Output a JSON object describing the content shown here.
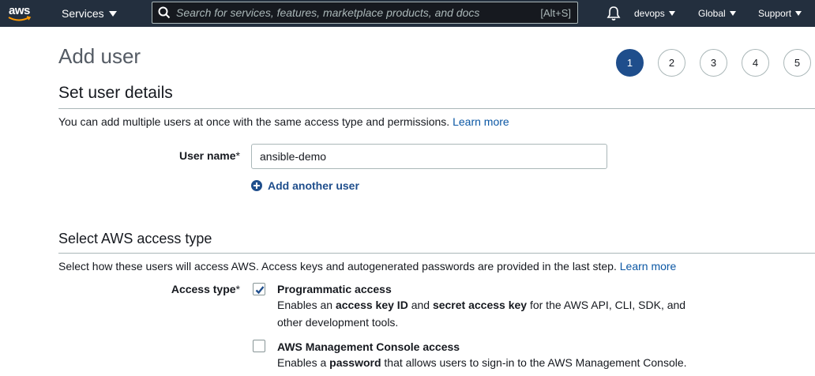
{
  "topnav": {
    "logo_text": "aws",
    "services_label": "Services",
    "search_placeholder": "Search for services, features, marketplace products, and docs",
    "search_shortcut": "[Alt+S]",
    "user_label": "devops",
    "region_label": "Global",
    "support_label": "Support",
    "icons": {
      "search": "search-icon",
      "bell": "bell-icon",
      "dropdown": "caret-down-icon"
    },
    "colors": {
      "background": "#232f3e",
      "logo_smile": "#ff9900"
    }
  },
  "page": {
    "title": "Add user",
    "steps": [
      "1",
      "2",
      "3",
      "4",
      "5"
    ],
    "active_step": "1",
    "accent_color": "#1f4e8c"
  },
  "user_details": {
    "title": "Set user details",
    "description": "You can add multiple users at once with the same access type and permissions.",
    "learn_more": "Learn more",
    "user_name_label": "User name",
    "required_marker": "*",
    "user_name_value": "ansible-demo",
    "add_another_user": "Add another user"
  },
  "access_type": {
    "title": "Select AWS access type",
    "description": "Select how these users will access AWS. Access keys and autogenerated passwords are provided in the last step.",
    "learn_more": "Learn more",
    "label": "Access type",
    "required_marker": "*",
    "options": [
      {
        "title": "Programmatic access",
        "checked": true,
        "desc_prefix": "Enables an",
        "bold1": "access key ID",
        "mid": "and",
        "bold2": "secret access key",
        "desc_suffix": "for the AWS API, CLI, SDK, and other development tools."
      },
      {
        "title": "AWS Management Console access",
        "checked": false,
        "desc_prefix": "Enables a",
        "bold1": "password",
        "desc_suffix": "that allows users to sign-in to the AWS Management Console."
      }
    ]
  }
}
